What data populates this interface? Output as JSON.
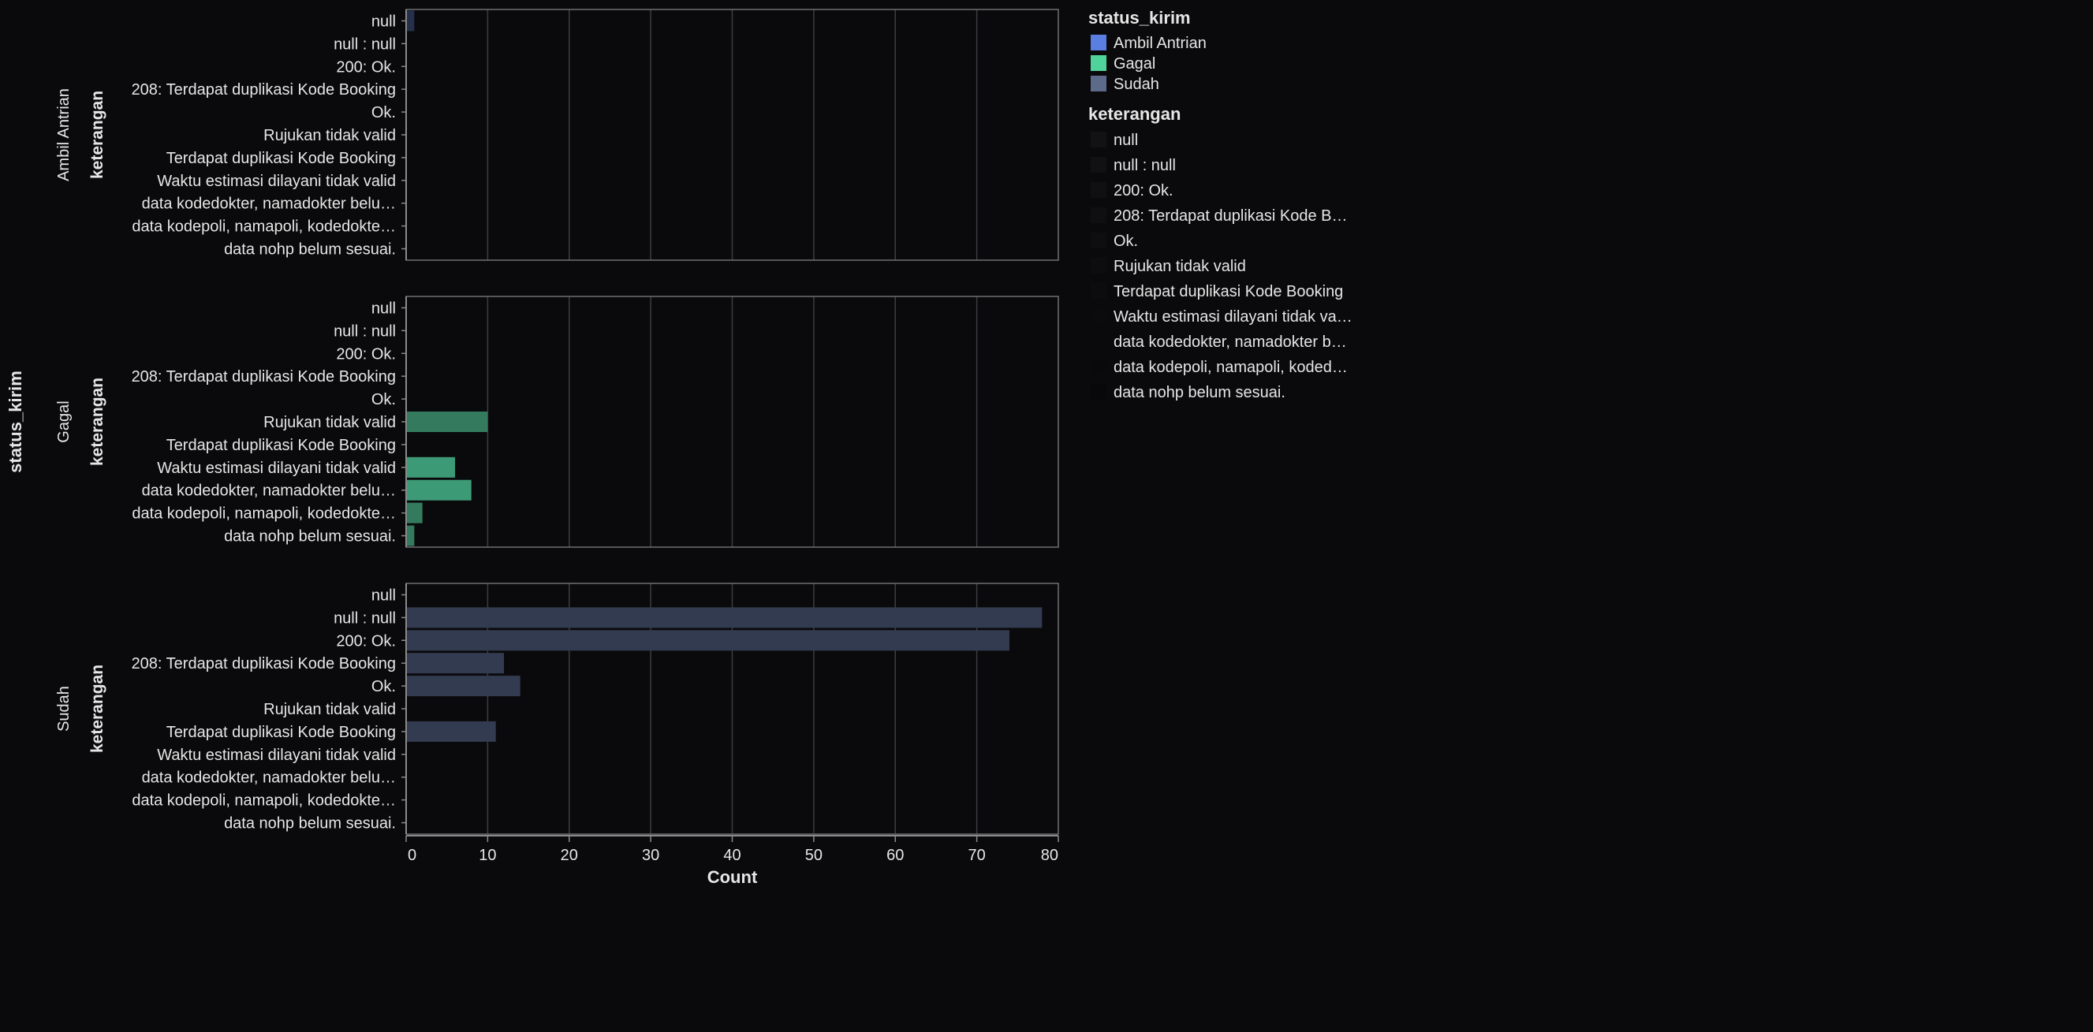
{
  "chart_data": {
    "type": "bar",
    "orientation": "horizontal",
    "facet": {
      "field_label": "status_kirim",
      "panels": [
        {
          "name": "Ambil Antrian",
          "color": "#26304a",
          "values": [
            1,
            0,
            0,
            0,
            0,
            0,
            0,
            0,
            0,
            0,
            0
          ]
        },
        {
          "name": "Gagal",
          "color_main": "#3d9a76",
          "color_dim": "#337a5e",
          "values": [
            0,
            0,
            0,
            0,
            0,
            10,
            0,
            6,
            8,
            2,
            1
          ]
        },
        {
          "name": "Sudah",
          "color": "#323b4f",
          "values": [
            0,
            78,
            74,
            12,
            14,
            0,
            11,
            0,
            0,
            0,
            0
          ]
        }
      ]
    },
    "categories": [
      "null",
      "null : null",
      "200: Ok.",
      "208: Terdapat duplikasi Kode Booking",
      "Ok.",
      "Rujukan tidak valid",
      "Terdapat duplikasi Kode Booking",
      "Waktu estimasi dilayani tidak valid",
      "data kodedokter, namadokter  belu…",
      "data kodepoli, namapoli, kodedokte…",
      "data nohp  belum sesuai."
    ],
    "ylabel": "keterangan",
    "xlabel": "Count",
    "xlim": [
      0,
      80
    ],
    "x_ticks": [
      0,
      10,
      20,
      30,
      40,
      50,
      60,
      70,
      80
    ],
    "grid": true,
    "legend_placement": "right",
    "legends": [
      {
        "title": "status_kirim",
        "entries": [
          {
            "label": "Ambil Antrian",
            "color": "#5b7fe0"
          },
          {
            "label": "Gagal",
            "color": "#4fd39a"
          },
          {
            "label": "Sudah",
            "color": "#5d6a8a"
          }
        ]
      },
      {
        "title": "keterangan",
        "entries": [
          {
            "label": "null",
            "color": "#121214"
          },
          {
            "label": "null : null",
            "color": "#111113"
          },
          {
            "label": "200: Ok.",
            "color": "#101012"
          },
          {
            "label": "208: Terdapat duplikasi Kode B…",
            "color": "#0f0f11"
          },
          {
            "label": "Ok.",
            "color": "#0e0e10"
          },
          {
            "label": "Rujukan tidak valid",
            "color": "#0d0d0f"
          },
          {
            "label": "Terdapat duplikasi Kode Booking",
            "color": "#0c0c0e"
          },
          {
            "label": "Waktu estimasi dilayani tidak va…",
            "color": "#0b0b0d"
          },
          {
            "label": "data kodedokter, namadokter  b…",
            "color": "#0a0a0c"
          },
          {
            "label": "data kodepoli, namapoli, koded…",
            "color": "#09090b"
          },
          {
            "label": "data nohp  belum sesuai.",
            "color": "#08080a"
          }
        ]
      }
    ],
    "colors": {
      "background": "#0a0a0c",
      "frame": "#707070",
      "grid": "#3a3a3e",
      "text": "#e6e6e6"
    }
  }
}
